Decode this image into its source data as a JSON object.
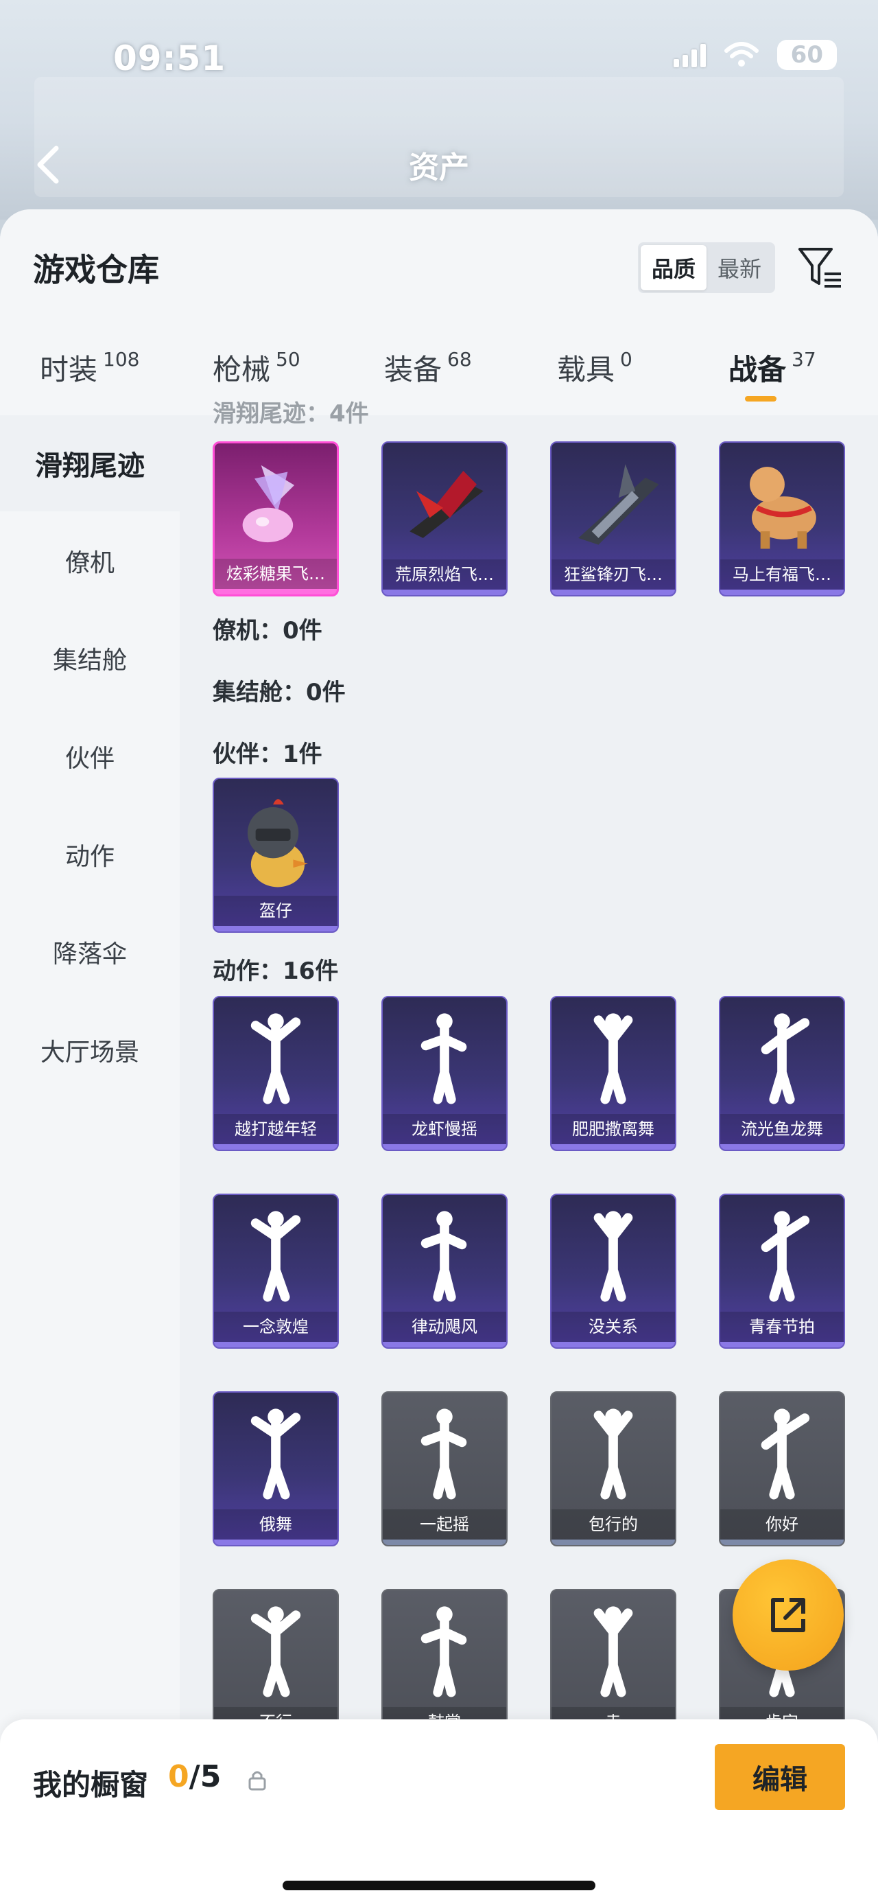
{
  "status": {
    "time": "09:51",
    "battery": "60"
  },
  "nav": {
    "title": "资产"
  },
  "sheet": {
    "title": "游戏仓库",
    "sort_options": [
      "品质",
      "最新"
    ],
    "active_sort": "品质"
  },
  "tabs": [
    {
      "label": "时装",
      "count": "108"
    },
    {
      "label": "枪械",
      "count": "50"
    },
    {
      "label": "装备",
      "count": "68"
    },
    {
      "label": "载具",
      "count": "0"
    },
    {
      "label": "战备",
      "count": "37"
    }
  ],
  "active_tab": "战备",
  "sidebar": {
    "items": [
      "滑翔尾迹",
      "僚机",
      "集结舱",
      "伙伴",
      "动作",
      "降落伞",
      "大厅场景"
    ],
    "active": "滑翔尾迹"
  },
  "sections": {
    "trail_partial": "滑翔尾迹：4件",
    "wingman": "僚机：0件",
    "pod": "集结舱：0件",
    "partner": "伙伴：1件",
    "emote": "动作：16件"
  },
  "trail_items": [
    "炫彩糖果飞…",
    "荒原烈焰飞…",
    "狂鲨锋刃飞…",
    "马上有福飞…"
  ],
  "partner_items": [
    "盔仔"
  ],
  "emote_items": [
    "越打越年轻",
    "龙虾慢摇",
    "肥肥撒离舞",
    "流光鱼龙舞",
    "一念敦煌",
    "律动飓风",
    "没关系",
    "青春节拍",
    "俄舞",
    "一起摇",
    "包行的",
    "你好",
    "不行",
    "鼓掌",
    "走",
    "肯定"
  ],
  "bottom": {
    "title": "我的橱窗",
    "used": "0",
    "total": "/5",
    "edit_label": "编辑"
  },
  "icons": {
    "back": "chevron-left-icon",
    "filter": "filter-icon",
    "share": "share-external-icon",
    "lock": "lock-icon",
    "wifi": "wifi-icon",
    "signal": "signal-icon"
  },
  "colors": {
    "accent": "#f5a623",
    "card_purple": "#3b3675",
    "card_pink": "#b33a9b",
    "card_gray": "#4c4f57"
  }
}
